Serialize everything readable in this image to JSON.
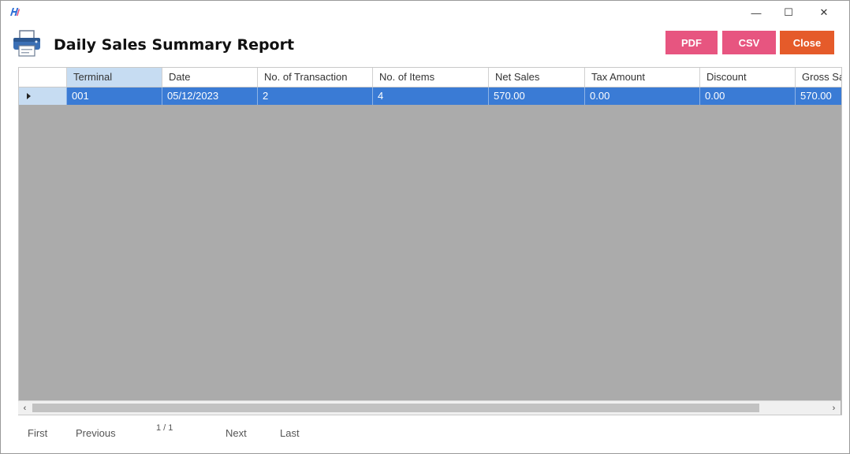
{
  "window": {
    "title": "",
    "minimize_glyph": "—",
    "maximize_glyph": "☐",
    "close_glyph": "✕"
  },
  "header": {
    "title": "Daily Sales Summary Report",
    "icon": "printer-icon",
    "buttons": {
      "pdf_label": "PDF",
      "csv_label": "CSV",
      "close_label": "Close"
    },
    "colors": {
      "pdf": "#e75580",
      "csv": "#e75580",
      "close": "#e55b2a",
      "selection": "#3a7bd5"
    }
  },
  "grid": {
    "columns": [
      "Terminal",
      "Date",
      "No. of Transaction",
      "No. of Items",
      "Net Sales",
      "Tax Amount",
      "Discount",
      "Gross Sa"
    ],
    "rows": [
      {
        "cells": [
          "001",
          "05/12/2023",
          "2",
          "4",
          "570.00",
          "0.00",
          "0.00",
          "570.00"
        ]
      }
    ]
  },
  "scrollbar": {
    "left_glyph": "‹",
    "right_glyph": "›"
  },
  "pager": {
    "first": "First",
    "previous": "Previous",
    "page": "1 / 1",
    "next": "Next",
    "last": "Last"
  }
}
